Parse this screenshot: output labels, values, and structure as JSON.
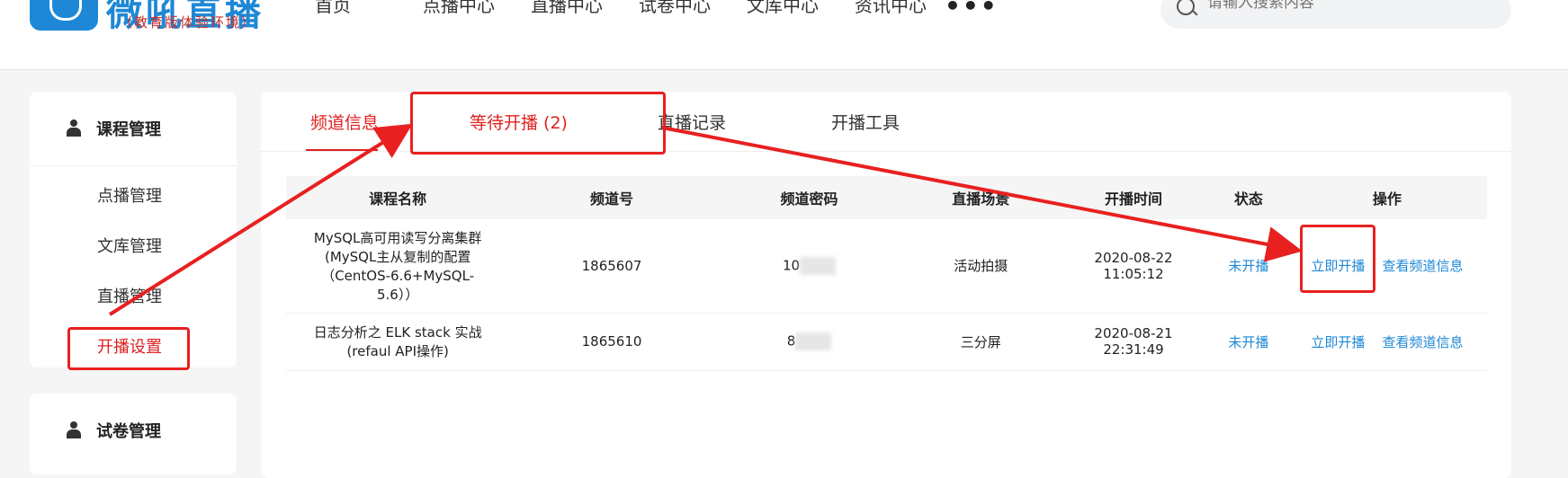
{
  "header": {
    "logo_text": "微吼直播",
    "logo_sub": "（教育版体验环境）",
    "nav": [
      "首页",
      "点播中心",
      "直播中心",
      "试卷中心",
      "文库中心",
      "资讯中心"
    ],
    "more": "•••",
    "search_placeholder": "请输入搜索内容"
  },
  "sidebar": {
    "section1_title": "课程管理",
    "items": [
      "点播管理",
      "文库管理",
      "直播管理",
      "开播设置"
    ],
    "section2_title": "试卷管理"
  },
  "tabs": [
    "频道信息",
    "等待开播 (2)",
    "直播记录",
    "开播工具"
  ],
  "table": {
    "headers": [
      "课程名称",
      "频道号",
      "频道密码",
      "直播场景",
      "开播时间",
      "状态",
      "操作"
    ],
    "rows": [
      {
        "name_lines": [
          "MySQL高可用读写分离集群",
          "(MySQL主从复制的配置",
          "（CentOS-6.6+MySQL-",
          "5.6））"
        ],
        "channel": "1865607",
        "password": "10",
        "scene": "活动拍摄",
        "time_date": "2020-08-22",
        "time_clock": "11:05:12",
        "status": "未开播",
        "action1": "立即开播",
        "action2": "查看频道信息"
      },
      {
        "name_lines": [
          "日志分析之 ELK stack 实战",
          "(refaul API操作)"
        ],
        "channel": "1865610",
        "password": "8",
        "scene": "三分屏",
        "time_date": "2020-08-21",
        "time_clock": "22:31:49",
        "status": "未开播",
        "action1": "立即开播",
        "action2": "查看频道信息"
      }
    ]
  },
  "colors": {
    "accent_blue": "#1e88d6",
    "annotation_red": "#e82020"
  }
}
